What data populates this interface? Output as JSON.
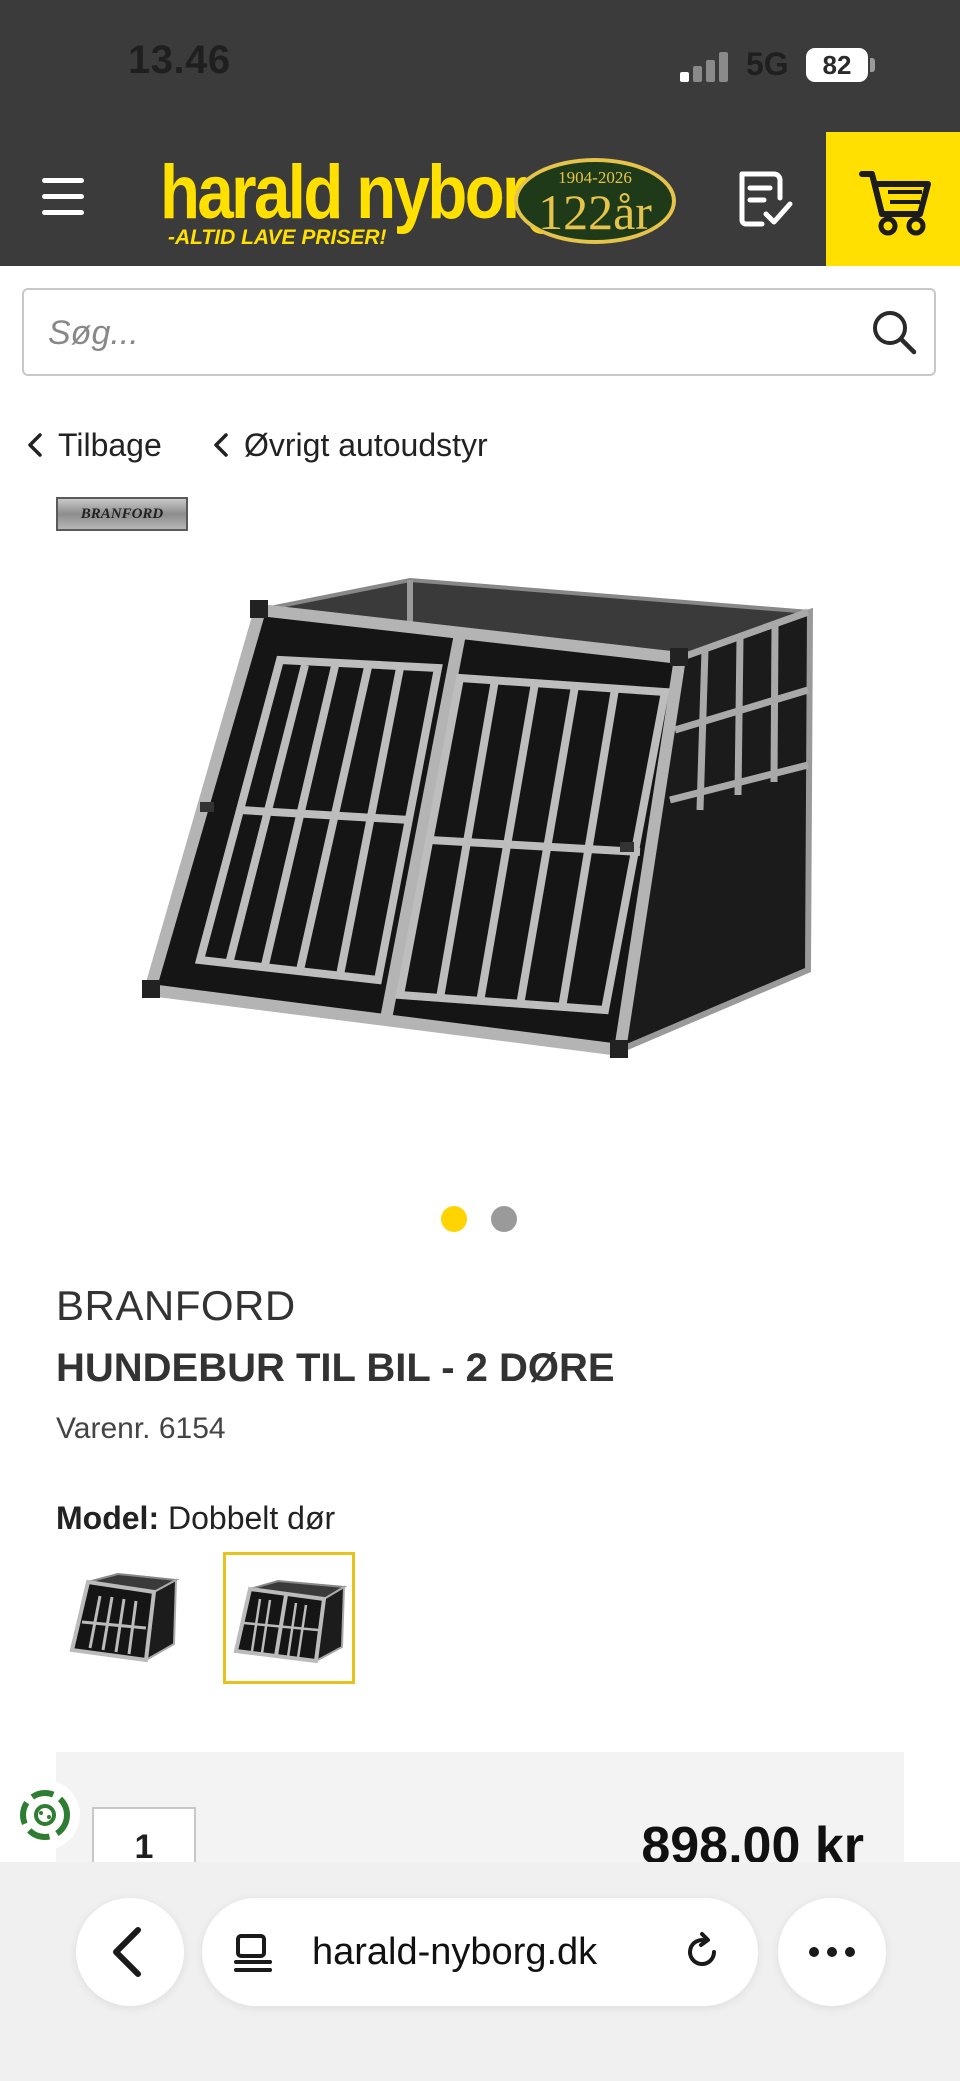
{
  "status_bar": {
    "time": "13.46",
    "network": "5G",
    "battery": "82"
  },
  "header": {
    "logo_name": "harald nyborg",
    "logo_tagline": "-ALTID LAVE PRISER!",
    "badge_years": "1904-2026",
    "badge_age": "122år",
    "icons": [
      "menu-icon",
      "checklist-icon",
      "cart-icon"
    ],
    "colors": {
      "header_bg": "#3b3b3b",
      "accent": "#ffe000"
    }
  },
  "search": {
    "placeholder": "Søg..."
  },
  "breadcrumbs": {
    "back": "Tilbage",
    "category": "Øvrigt autoudstyr"
  },
  "product": {
    "brand_logo": "BRANFORD",
    "brand": "BRANFORD",
    "title": "HUNDEBUR TIL BIL - 2 DØRE",
    "sku": "Varenr. 6154",
    "model_label": "Model:",
    "model_value": "Dobbelt dør",
    "image_count": 2,
    "active_image": 1,
    "variants_selected": 2
  },
  "purchase": {
    "quantity": "1",
    "price": "898,00 kr"
  },
  "browser": {
    "url": "harald-nyborg.dk",
    "icons": [
      "back-icon",
      "reader-icon",
      "reload-icon",
      "more-icon"
    ]
  }
}
